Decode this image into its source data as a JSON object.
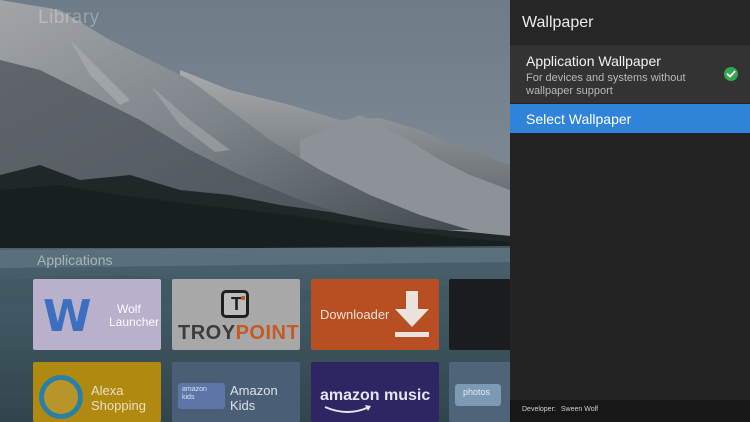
{
  "background": {
    "faded_title": "Library",
    "section_label": "Applications"
  },
  "apps": {
    "wolf": {
      "mark": "W",
      "label_line1": "Wolf",
      "label_line2": "Launcher",
      "color": "#b9b1cc"
    },
    "troypoint": {
      "box_letter": "T",
      "word_part1": "TROY",
      "word_part2": "POINT",
      "accent_color": "#c65a22"
    },
    "downloader": {
      "label": "Downloader",
      "color": "#b84f22"
    },
    "alexa": {
      "label_line1": "Alexa",
      "label_line2": "Shopping",
      "color": "#b08a10"
    },
    "amazon_kids": {
      "badge_line1": "amazon",
      "badge_line2": "kids",
      "label_line1": "Amazon",
      "label_line2": "Kids",
      "color": "#4a5f75"
    },
    "amazon_music": {
      "label": "amazon music",
      "color": "#2c2663"
    },
    "photos": {
      "badge": "photos",
      "color": "#4f6478"
    }
  },
  "panel": {
    "title": "Wallpaper",
    "options": [
      {
        "title": "Application Wallpaper",
        "description": "For devices and systems without wallpaper support",
        "selected": true,
        "icon": "check-circle-icon"
      },
      {
        "title": "Select Wallpaper",
        "focused": true
      }
    ],
    "footer": {
      "label": "Developer:",
      "value": "Sween Wolf"
    },
    "accent_color": "#2f84d9",
    "check_color": "#2fa84f"
  }
}
